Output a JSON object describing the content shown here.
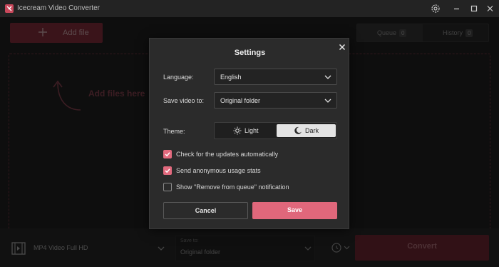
{
  "window": {
    "title": "Icecream Video Converter",
    "icons": [
      "app-logo-icon",
      "gear-icon",
      "minimize-icon",
      "maximize-icon",
      "close-icon"
    ]
  },
  "toolbar": {
    "add_file_label": "Add file",
    "tabs": [
      {
        "label": "Queue",
        "count": "0",
        "active": true
      },
      {
        "label": "History",
        "count": "0",
        "active": false
      }
    ]
  },
  "dropzone": {
    "hint": "Add files here"
  },
  "bottom": {
    "format_label": "MP4 Video Full HD",
    "save_to_caption": "Save to:",
    "save_to_value": "Original folder",
    "convert_label": "Convert"
  },
  "settings": {
    "title": "Settings",
    "language_label": "Language:",
    "language_value": "English",
    "save_video_label": "Save video to:",
    "save_video_value": "Original folder",
    "theme_label": "Theme:",
    "theme_options": [
      {
        "label": "Light",
        "icon": "sun-icon",
        "selected": false
      },
      {
        "label": "Dark",
        "icon": "moon-icon",
        "selected": true
      }
    ],
    "checkboxes": [
      {
        "label": "Check for the updates automatically",
        "checked": true
      },
      {
        "label": "Send anonymous usage stats",
        "checked": true
      },
      {
        "label": "Show \"Remove from queue\" notification",
        "checked": false
      }
    ],
    "cancel_label": "Cancel",
    "save_label": "Save"
  },
  "colors": {
    "accent": "#e0677b",
    "background": "#1b1b1b",
    "dialog": "#2b2b2b"
  }
}
